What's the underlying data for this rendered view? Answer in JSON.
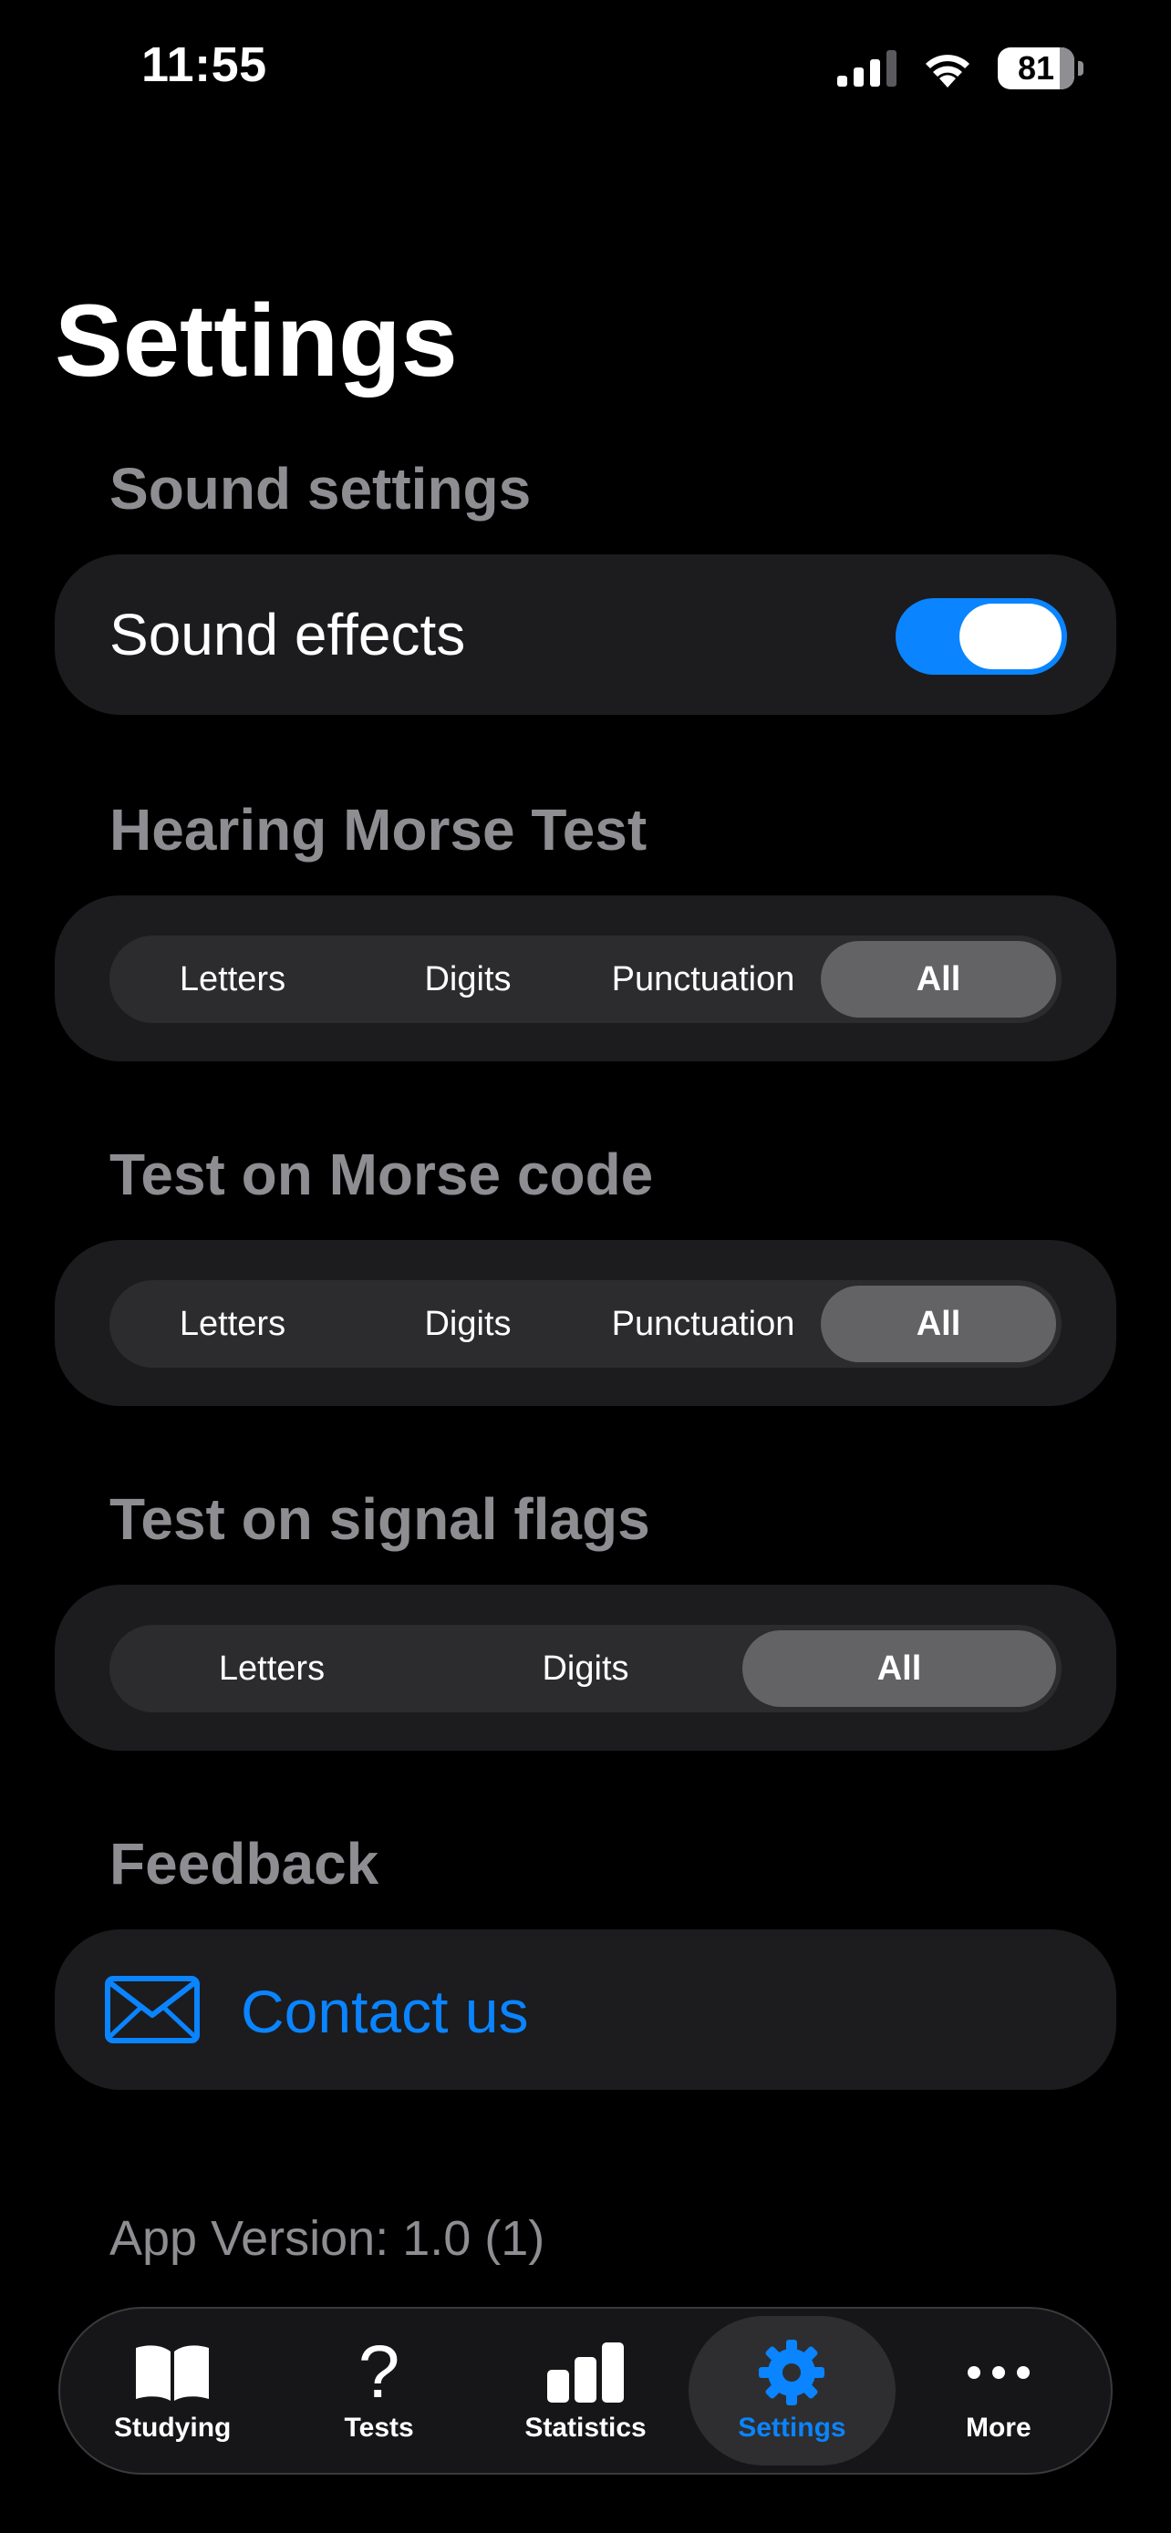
{
  "status_bar": {
    "time": "11:55",
    "battery_level": "81",
    "battery_fraction": 0.81
  },
  "header": {
    "title": "Settings"
  },
  "sound_settings": {
    "header": "Sound settings",
    "sound_effects_label": "Sound effects",
    "sound_effects_enabled": true
  },
  "hearing_morse_test": {
    "header": "Hearing Morse Test",
    "options": [
      "Letters",
      "Digits",
      "Punctuation",
      "All"
    ],
    "selected": "All"
  },
  "test_on_morse_code": {
    "header": "Test on Morse code",
    "options": [
      "Letters",
      "Digits",
      "Punctuation",
      "All"
    ],
    "selected": "All"
  },
  "test_on_signal_flags": {
    "header": "Test on signal flags",
    "options": [
      "Letters",
      "Digits",
      "All"
    ],
    "selected": "All"
  },
  "feedback": {
    "header": "Feedback",
    "contact_label": "Contact us",
    "icon": "envelope-icon"
  },
  "app_version": "App Version: 1.0 (1)",
  "tab_bar": {
    "tabs": [
      {
        "label": "Studying",
        "icon": "book-icon"
      },
      {
        "label": "Tests",
        "icon": "question-mark-icon"
      },
      {
        "label": "Statistics",
        "icon": "bar-chart-icon"
      },
      {
        "label": "Settings",
        "icon": "gear-icon"
      },
      {
        "label": "More",
        "icon": "ellipsis-icon"
      }
    ],
    "active": "Settings"
  },
  "colors": {
    "accent": "#0a84ff",
    "background": "#000000",
    "card": "#1c1c1e",
    "section_header": "#8d8d92",
    "segment_selected": "#636366"
  }
}
